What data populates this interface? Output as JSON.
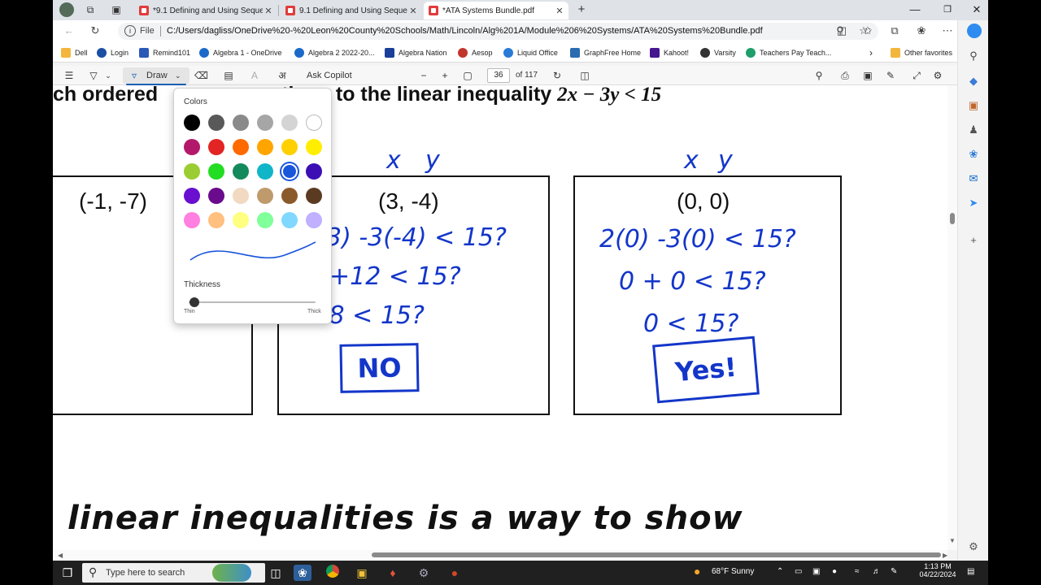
{
  "tabs": [
    {
      "label": "*9.1 Defining and Using Sequence",
      "active": false
    },
    {
      "label": "9.1 Defining and Using Sequence",
      "active": false
    },
    {
      "label": "*ATA Systems Bundle.pdf",
      "active": true
    }
  ],
  "address": {
    "info": "i",
    "scheme_label": "File",
    "url": "C:/Users/dagliss/OneDrive%20-%20Leon%20County%20Schools/Math/Lincoln/Alg%201A/Module%206%20Systems/ATA%20Systems%20Bundle.pdf"
  },
  "favorites": [
    "Dell",
    "Login",
    "Remind101",
    "Algebra 1 - OneDrive",
    "Algebra 2 2022-20...",
    "Algebra Nation",
    "Aesop",
    "Liquid Office",
    "GraphFree Home",
    "Kahoot!",
    "Varsity",
    "Teachers Pay Teach..."
  ],
  "favorites_other": "Other favorites",
  "pdf_toolbar": {
    "draw_label": "Draw",
    "copilot_label": "Ask Copilot",
    "page_current": "36",
    "page_total": "of 117"
  },
  "draw_panel": {
    "colors_title": "Colors",
    "thickness_title": "Thickness",
    "thin_label": "Thin",
    "thick_label": "Thick",
    "thickness_level": 0.02,
    "selected_color": "#1a56db",
    "swatches": [
      [
        "#000000",
        "#595959",
        "#8a8a8a",
        "#a6a6a6",
        "#d4d4d4",
        "#ffffff"
      ],
      [
        "#b3186b",
        "#e22424",
        "#ff6a00",
        "#ffa500",
        "#ffd000",
        "#ffee00"
      ],
      [
        "#9acd32",
        "#22dd22",
        "#128a5c",
        "#11b5c8",
        "#1a56db",
        "#3c0fb4"
      ],
      [
        "#6a0fcf",
        "#6a0a8c",
        "#f1d9c2",
        "#bf9a6c",
        "#8b5a2b",
        "#5a3b22"
      ],
      [
        "#ff80e0",
        "#ffc080",
        "#ffff80",
        "#80ff9a",
        "#80d8ff",
        "#c0b0ff"
      ]
    ]
  },
  "document": {
    "heading_prefix": "ch ordered",
    "heading_suffix": "tions to the linear inequality ",
    "heading_math": "2x − 3y < 15",
    "boxes": [
      {
        "pair": "(-1, -7)"
      },
      {
        "pair": "(3, -4)",
        "label_x": "x",
        "label_y": "y",
        "work": [
          "3) -3(-4) < 15?",
          "+12 < 15?",
          ".8 < 15?"
        ],
        "verdict": "NO"
      },
      {
        "pair": "(0, 0)",
        "label_x": "x",
        "label_y": "y",
        "work": [
          "2(0) -3(0) < 15?",
          "0 + 0 < 15?",
          "0 < 15?"
        ],
        "verdict": "Yes!"
      }
    ],
    "bottom_text": "linear inequalities is a way to show"
  },
  "taskbar": {
    "search_placeholder": "Type here to search",
    "weather": "68°F  Sunny",
    "time": "1:13 PM",
    "date": "04/22/2024"
  }
}
